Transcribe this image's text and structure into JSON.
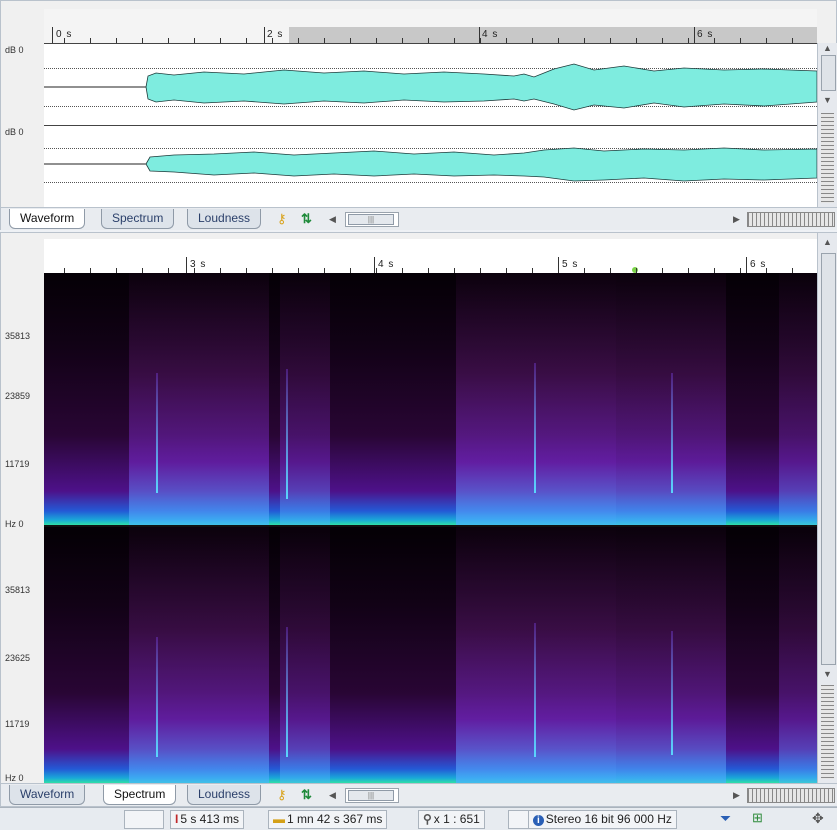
{
  "waveform_panel": {
    "ruler_labels": [
      "0 s",
      "2 s",
      "4 s",
      "6 s"
    ],
    "channel_labels": [
      "dB 0",
      "dB 0"
    ],
    "wave_color": "#7eecdf"
  },
  "tabs_top": {
    "waveform": "Waveform",
    "spectrum": "Spectrum",
    "loudness": "Loudness"
  },
  "spectrum_panel": {
    "ruler_labels": [
      "3 s",
      "4 s",
      "5 s",
      "6 s"
    ],
    "channel1_axis": [
      "35813",
      "23859",
      "11719",
      "Hz 0"
    ],
    "channel2_axis": [
      "35813",
      "23625",
      "11719",
      "Hz 0"
    ]
  },
  "tabs_bottom": {
    "waveform": "Waveform",
    "spectrum": "Spectrum",
    "loudness": "Loudness"
  },
  "status_bar": {
    "position": "5 s 413 ms",
    "duration": "1 mn 42 s 367 ms",
    "zoom": "x 1 : 651",
    "format": "Stereo 16 bit 96 000 Hz"
  },
  "icons": {
    "tool1": "key-icon",
    "tool2": "up-down-arrow-icon",
    "cursor": "cursor-i-icon",
    "length": "ruler-icon",
    "zoom": "magnifier-icon",
    "info": "info-icon",
    "filter": "funnel-icon",
    "snap": "snap-icon",
    "move": "move-cross-icon"
  }
}
